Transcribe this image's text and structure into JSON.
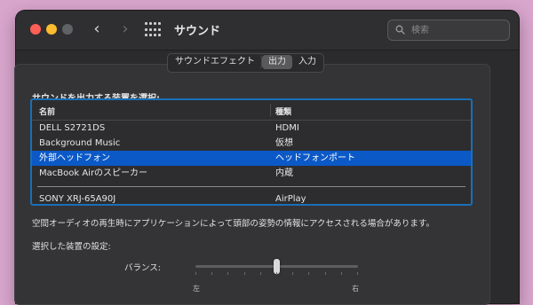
{
  "window": {
    "title": "サウンド"
  },
  "search": {
    "placeholder": "検索"
  },
  "tabs": [
    {
      "label": "サウンドエフェクト",
      "selected": false
    },
    {
      "label": "出力",
      "selected": true
    },
    {
      "label": "入力",
      "selected": false
    }
  ],
  "output": {
    "section_label": "サウンドを出力する装置を選択:",
    "columns": {
      "name": "名前",
      "type": "種類"
    },
    "devices": [
      {
        "name": "DELL S2721DS",
        "type": "HDMI"
      },
      {
        "name": "Background Music",
        "type": "仮想"
      },
      {
        "name": "外部ヘッドフォン",
        "type": "ヘッドフォンポート",
        "selected": true
      },
      {
        "name": "MacBook Airのスピーカー",
        "type": "内蔵"
      },
      {
        "name": "SONY XRJ-65A90J",
        "type": "AirPlay"
      }
    ],
    "note": "空間オーディオの再生時にアプリケーションによって頭部の姿勢の情報にアクセスされる場合があります。",
    "settings_label": "選択した装置の設定:",
    "balance": {
      "label": "バランス:",
      "left": "左",
      "right": "右",
      "value": 0.5
    }
  },
  "colors": {
    "selection": "#0b59c7",
    "focus_ring": "#1a6fb7",
    "close": "#fe5f57",
    "minimize": "#febc2e"
  }
}
